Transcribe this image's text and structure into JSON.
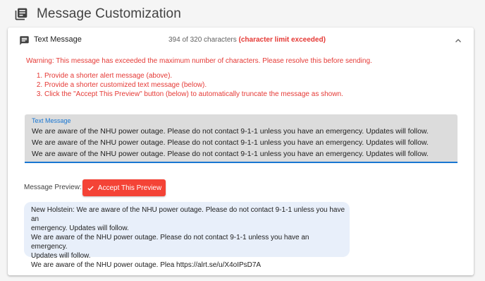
{
  "header": {
    "title": "Message Customization",
    "icon": "library-books-icon"
  },
  "panel": {
    "title": "Text Message",
    "icon": "message-icon",
    "char_count": "394 of 320 characters",
    "limit_status": "(character limit exceeded)",
    "collapse_icon": "chevron-up-icon"
  },
  "warning": {
    "text": "Warning: This message has exceeded the maximum number of characters. Please resolve this before sending.",
    "steps": [
      "Provide a shorter alert message (above).",
      "Provide a shorter customized text message (below).",
      "Click the \"Accept This Preview\" button (below) to automatically truncate the message as shown."
    ]
  },
  "text_field": {
    "label": "Text Message",
    "value": "We are aware of the NHU power outage. Please do not contact 9-1-1 unless you have an emergency. Updates will follow.\nWe are aware of the NHU power outage. Please do not contact 9-1-1 unless you have an emergency. Updates will follow.\nWe are aware of the NHU power outage. Please do not contact 9-1-1 unless you have an emergency. Updates will follow."
  },
  "preview": {
    "label": "Message Preview:",
    "accept_button": "Accept This Preview",
    "accept_icon": "check-icon",
    "text": "New Holstein: We are aware of the NHU power outage. Please do not contact 9-1-1 unless you have an\nemergency. Updates will follow.\nWe are aware of the NHU power outage. Please do not contact 9-1-1 unless you have an emergency.\nUpdates will follow.\nWe are aware of the NHU power outage. Plea https://alrt.se/u/X4oIPsD7A"
  },
  "colors": {
    "error": "#e53935",
    "accent": "#1976d2",
    "button": "#f44336",
    "preview_bg": "#e8effa",
    "field_bg": "#dcdcdc"
  }
}
